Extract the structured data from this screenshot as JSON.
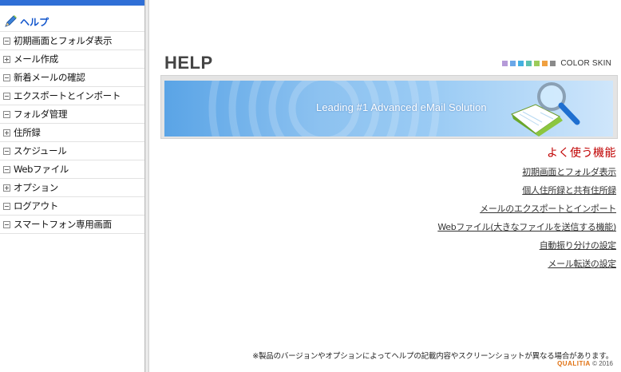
{
  "sidebar": {
    "title": "ヘルプ",
    "items": [
      {
        "label": "初期画面とフォルダ表示",
        "icon": "minus-box-icon"
      },
      {
        "label": "メール作成",
        "icon": "plus-box-icon"
      },
      {
        "label": "新着メールの確認",
        "icon": "minus-box-icon"
      },
      {
        "label": "エクスポートとインポート",
        "icon": "minus-box-icon"
      },
      {
        "label": "フォルダ管理",
        "icon": "minus-box-icon"
      },
      {
        "label": "住所録",
        "icon": "plus-box-icon"
      },
      {
        "label": "スケジュール",
        "icon": "minus-box-icon"
      },
      {
        "label": "Webファイル",
        "icon": "minus-box-icon"
      },
      {
        "label": "オプション",
        "icon": "plus-box-icon"
      },
      {
        "label": "ログアウト",
        "icon": "minus-box-icon"
      },
      {
        "label": "スマートフォン専用画面",
        "icon": "minus-box-icon"
      }
    ]
  },
  "main": {
    "page_title": "HELP",
    "color_skin": {
      "label": "COLOR SKIN",
      "swatches": [
        "#b59ad8",
        "#6aa7e8",
        "#44b0e0",
        "#5cc0b0",
        "#9ccc5a",
        "#f0a040",
        "#8a8a8a"
      ]
    },
    "banner_text": "Leading #1 Advanced eMail Solution",
    "section_title": "よく使う機能",
    "links": [
      "初期画面とフォルダ表示",
      "個人住所録と共有住所録",
      "メールのエクスポートとインポート",
      "Webファイル(大きなファイルを送信する機能)",
      "自動振り分けの設定",
      "メール転送の設定"
    ],
    "footer_note": "※製品のバージョンやオプションによってヘルプの記載内容やスクリーンショットが異なる場合があります。",
    "copyright_brand": "QUALITIA",
    "copyright_rest": "© 2016"
  }
}
